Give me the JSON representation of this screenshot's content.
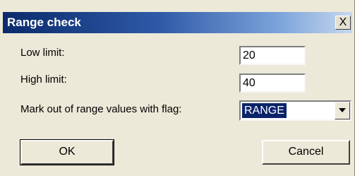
{
  "dialog": {
    "title": "Range check",
    "close_symbol": "X"
  },
  "fields": {
    "low_limit": {
      "label": "Low limit:",
      "value": "20"
    },
    "high_limit": {
      "label": "High limit:",
      "value": "40"
    },
    "flag": {
      "label": "Mark out of range values with flag:",
      "selected": "RANGE"
    }
  },
  "buttons": {
    "ok_label": "OK",
    "cancel_label": "Cancel"
  },
  "icons": {
    "close": "close-icon",
    "dropdown": "chevron-down-icon"
  },
  "colors": {
    "titlebar_start": "#0a2a6b",
    "selection": "#0a246a",
    "dialog_bg": "#ECE9D8"
  }
}
